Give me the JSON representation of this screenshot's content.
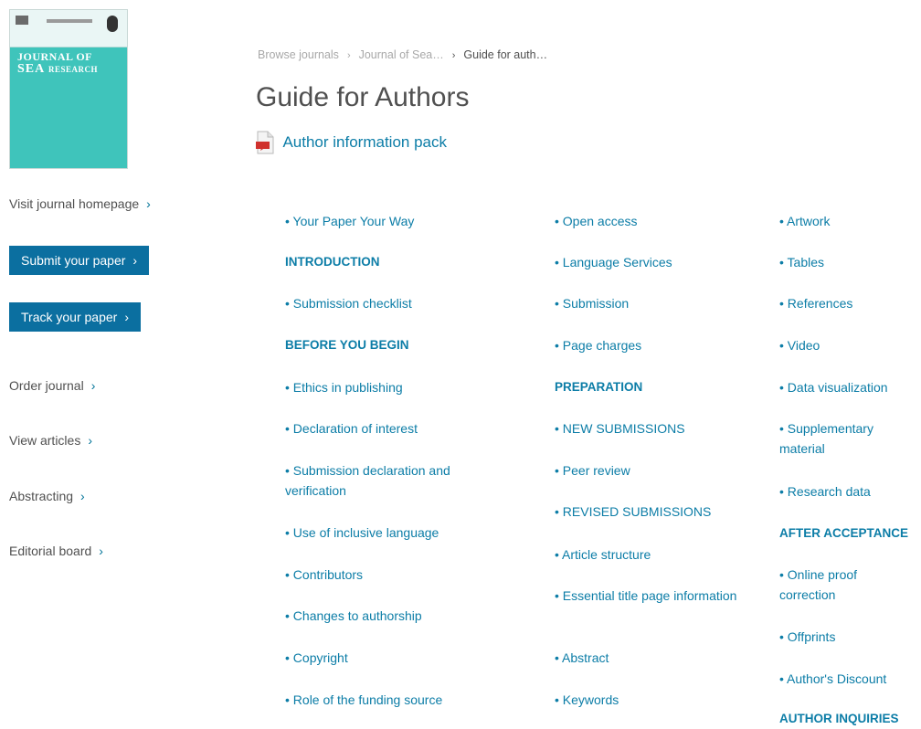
{
  "cover": {
    "title_line1": "JOURNAL OF",
    "title_line2": "SEA",
    "title_line2b": "RESEARCH"
  },
  "sidebar": {
    "visit_homepage": "Visit journal homepage",
    "submit_paper": "Submit your paper",
    "track_paper": "Track your paper",
    "order_journal": "Order journal",
    "view_articles": "View articles",
    "abstracting": "Abstracting",
    "editorial_board": "Editorial board",
    "chevron": "›"
  },
  "breadcrumb": {
    "items": [
      "Browse journals",
      "Journal of Sea…",
      "Guide for auth…"
    ],
    "separator": "›"
  },
  "page_title": "Guide for Authors",
  "author_pack": {
    "label": "Author information pack",
    "icon": "pdf-icon"
  },
  "toc": {
    "col1": [
      "• Your Paper Your Way",
      "INTRODUCTION",
      "• Submission checklist",
      "BEFORE YOU BEGIN",
      "• Ethics in publishing",
      "• Declaration of interest",
      "• Submission declaration and verification",
      "• Use of inclusive language",
      "• Contributors",
      "• Changes to authorship",
      "• Copyright",
      "• Role of the funding source"
    ],
    "col2": [
      "• Open access",
      "• Language Services",
      "• Submission",
      "• Page charges",
      "PREPARATION",
      "• NEW SUBMISSIONS",
      "• Peer review",
      "• REVISED SUBMISSIONS",
      "• Article structure",
      "• Essential title page information",
      "• Abstract",
      "• Keywords"
    ],
    "col3": [
      "• Artwork",
      "• Tables",
      "• References",
      "• Video",
      "• Data visualization",
      "• Supplementary material",
      "• Research data",
      "AFTER ACCEPTANCE",
      "• Online proof correction",
      "• Offprints",
      "• Author's Discount",
      "AUTHOR INQUIRIES"
    ]
  },
  "colors": {
    "link": "#0c7da7",
    "button": "#0b6fa0",
    "text": "#505050",
    "cover": "#3fc4bb"
  }
}
